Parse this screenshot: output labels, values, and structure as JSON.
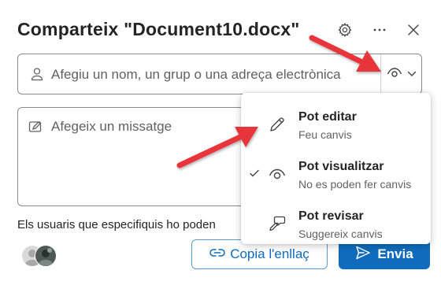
{
  "dialog": {
    "title": "Comparteix \"Document10.docx\"",
    "settings_icon": "gear-icon",
    "more_icon": "more-horizontal-icon",
    "close_icon": "close-icon"
  },
  "recipients": {
    "placeholder": "Afegiu un nom, un grup o una adreça electrònica",
    "person_icon": "person-icon",
    "permission_icon": "eye-icon",
    "dropdown_icon": "chevron-down-icon"
  },
  "message": {
    "placeholder": "Afegeix un missatge",
    "icon": "edit-icon"
  },
  "info_text": "Els usuaris que especifiquis ho poden",
  "buttons": {
    "copy_link": "Copia l'enllaç",
    "send": "Envia"
  },
  "permission_menu": {
    "items": [
      {
        "title": "Pot editar",
        "subtitle": "Feu canvis",
        "icon": "pencil-icon",
        "selected": false
      },
      {
        "title": "Pot visualitzar",
        "subtitle": "No es poden fer canvis",
        "icon": "eye-icon",
        "selected": true
      },
      {
        "title": "Pot revisar",
        "subtitle": "Suggereix canvis",
        "icon": "review-icon",
        "selected": false
      }
    ]
  },
  "colors": {
    "accent": "#0f6cbd",
    "annotation_arrow": "#e8363a"
  }
}
